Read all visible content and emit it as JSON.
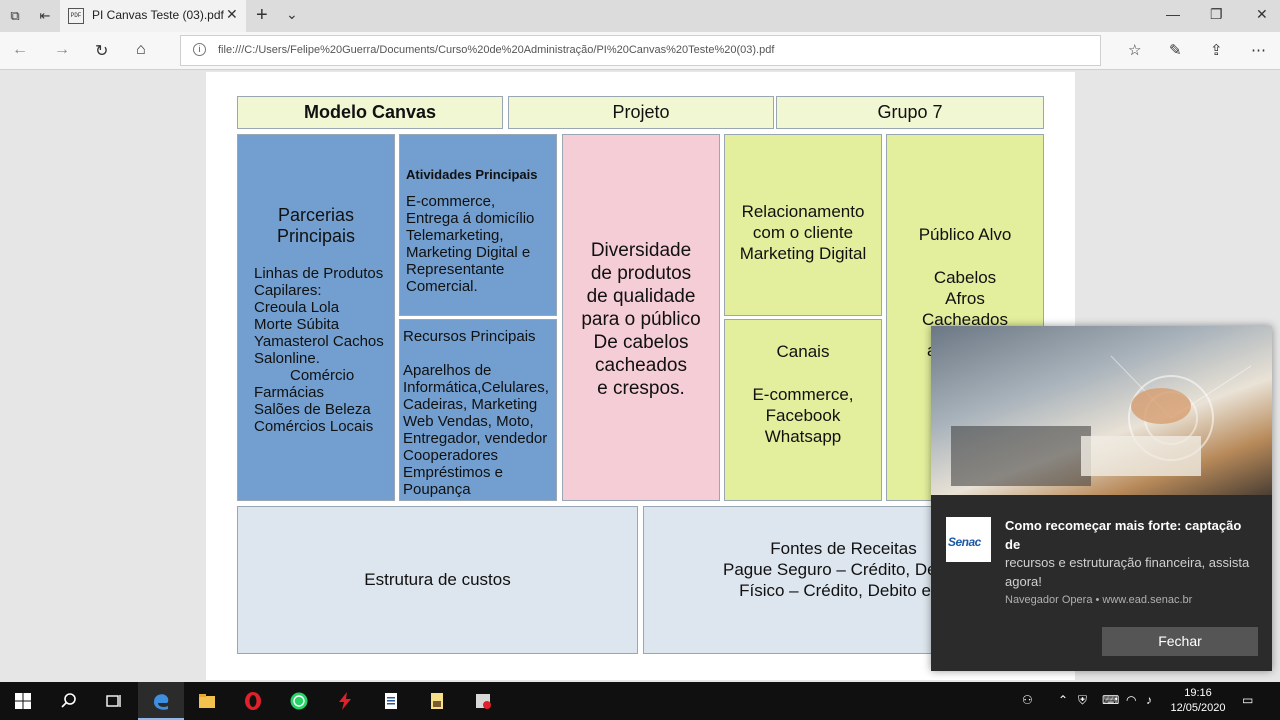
{
  "browser": {
    "tab_title": "PI Canvas Teste (03).pdf",
    "url": "file:///C:/Users/Felipe%20Guerra/Documents/Curso%20de%20Administração/PI%20Canvas%20Teste%20(03).pdf"
  },
  "canvas": {
    "header": [
      "Modelo Canvas",
      "Projeto",
      "Grupo 7"
    ],
    "parcerias_title": [
      "Parcerias",
      "Principais"
    ],
    "parcerias_body": [
      "Linhas de Produtos",
      "Capilares:",
      "Creoula Lola",
      "Morte Súbita",
      "Yamasterol Cachos",
      "Salonline.",
      "Comércio",
      "Farmácias",
      "Salões de Beleza",
      "Comércios Locais"
    ],
    "atividades_title": "Atividades Principais",
    "atividades_body": [
      "E-commerce,",
      "Entrega á domicílio",
      "Telemarketing,",
      "Marketing Digital e",
      "Representante",
      "Comercial."
    ],
    "recursos_title": "Recursos Principais",
    "recursos_body": [
      "Aparelhos de",
      "Informática,Celulares,",
      "Cadeiras, Marketing",
      "Web Vendas, Moto,",
      "Entregador, vendedor",
      "Cooperadores",
      "Empréstimos e",
      "Poupança"
    ],
    "proposta_body": [
      "Diversidade",
      "de produtos",
      "de qualidade",
      "para o público",
      "De cabelos",
      "cacheados",
      "e crespos."
    ],
    "relacionamento_body": [
      "Relacionamento",
      "com o cliente",
      "Marketing Digital"
    ],
    "canais_title": "Canais",
    "canais_body": [
      "E-commerce,",
      "Facebook",
      "Whatsapp"
    ],
    "publico_title": "Público Alvo",
    "publico_body": [
      "Cabelos",
      "Afros",
      "Cacheados",
      "a"
    ],
    "custos": "Estrutura de custos",
    "receitas_title": "Fontes de Receitas",
    "receitas_body": [
      "Pague Seguro – Crédito, Debito",
      "Físico – Crédito, Debito e D"
    ]
  },
  "notification": {
    "logo_text": "Senac",
    "title": "Como recomeçar mais forte: captação de",
    "body": "recursos e estruturação financeira, assista agora!",
    "source": "Navegador Opera • www.ead.senac.br",
    "button": "Fechar"
  },
  "clock": {
    "time": "19:16",
    "date": "12/05/2020"
  }
}
